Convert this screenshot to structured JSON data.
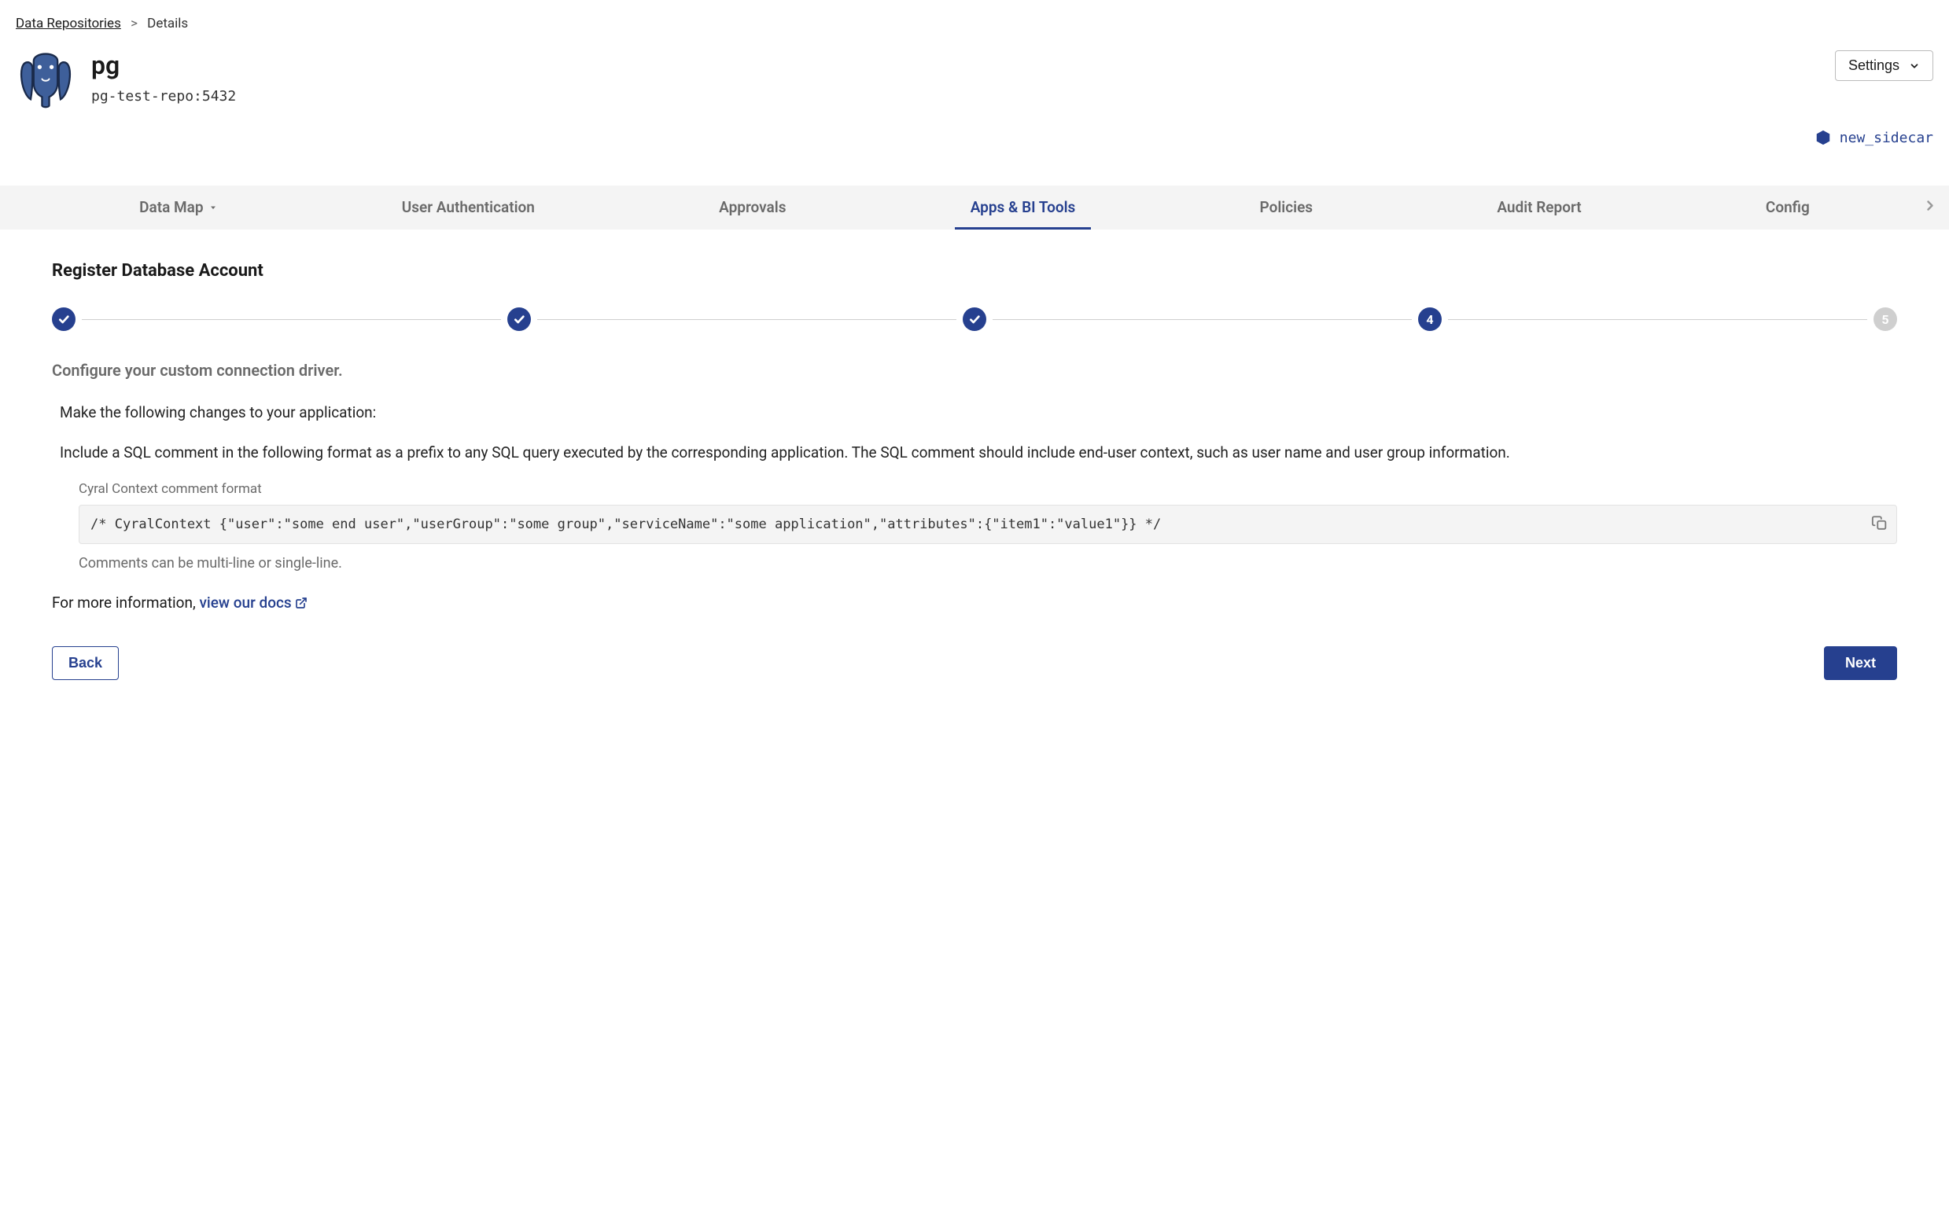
{
  "breadcrumb": {
    "root": "Data Repositories",
    "current": "Details"
  },
  "header": {
    "title": "pg",
    "host": "pg-test-repo:5432",
    "settings_label": "Settings"
  },
  "sidecar": {
    "name": "new_sidecar"
  },
  "tabs": {
    "items": [
      {
        "label": "Data Map",
        "has_dropdown": true
      },
      {
        "label": "User Authentication"
      },
      {
        "label": "Approvals"
      },
      {
        "label": "Apps & BI Tools",
        "active": true
      },
      {
        "label": "Policies"
      },
      {
        "label": "Audit Report"
      },
      {
        "label": "Config"
      }
    ]
  },
  "section": {
    "title": "Register Database Account",
    "stepper": {
      "total": 5,
      "completed": 3,
      "current": 4
    },
    "subtitle": "Configure your custom connection driver.",
    "intro": "Make the following changes to your application:",
    "description": "Include a SQL comment in the following format as a prefix to any SQL query executed by the corresponding application. The SQL comment should include end-user context, such as user name and user group information.",
    "code_label": "Cyral Context comment format",
    "code": "/* CyralContext {\"user\":\"some end user\",\"userGroup\":\"some group\",\"serviceName\":\"some application\",\"attributes\":{\"item1\":\"value1\"}} */",
    "hint": "Comments can be multi-line or single-line.",
    "docs_prefix": "For more information, ",
    "docs_link_text": "view our docs",
    "back_label": "Back",
    "next_label": "Next"
  }
}
